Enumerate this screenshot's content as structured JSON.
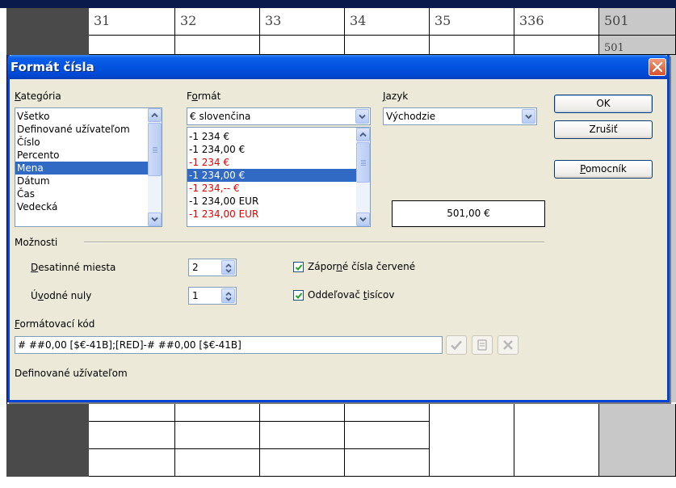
{
  "sheet": {
    "col_headers": [
      "31",
      "32",
      "33",
      "34",
      "35",
      "336",
      "501"
    ],
    "row2_value": "501"
  },
  "dialog": {
    "title": "Formát čísla",
    "category": {
      "label": "Kategória",
      "items": [
        "Všetko",
        "Definované užívateľom",
        "Číslo",
        "Percento",
        "Mena",
        "Dátum",
        "Čas",
        "Vedecká"
      ],
      "selected_index": 4
    },
    "format": {
      "label": "Formát",
      "currency_combo_value": "€ slovenčina",
      "items": [
        {
          "text": "-1 234 €",
          "negative_red": false
        },
        {
          "text": "-1 234,00 €",
          "negative_red": false
        },
        {
          "text": "-1 234 €",
          "negative_red": true
        },
        {
          "text": "-1 234,00 €",
          "negative_red": true
        },
        {
          "text": "-1 234,-- €",
          "negative_red": true
        },
        {
          "text": "-1 234,00 EUR",
          "negative_red": false
        },
        {
          "text": "-1 234,00 EUR",
          "negative_red": true
        }
      ],
      "selected_index": 3
    },
    "language": {
      "label": "Jazyk",
      "value": "Východzie"
    },
    "buttons": {
      "ok": "OK",
      "cancel": "Zrušiť",
      "help": "Pomocník"
    },
    "preview": "501,00 €",
    "options": {
      "label": "Možnosti",
      "decimal_places_label": "Desatinné miesta",
      "decimal_places_value": "2",
      "leading_zeros_label": "Úvodné nuly",
      "leading_zeros_value": "1",
      "negative_red_label": "Záporné čísla červené",
      "negative_red_checked": true,
      "thousands_sep_label": "Oddeľovač tisícov",
      "thousands_sep_checked": true
    },
    "format_code": {
      "label": "Formátovací kód",
      "value": "# ##0,00 [$€-41B];[RED]-# ##0,00 [$€-41B]"
    },
    "status_text": "Definované užívateľom"
  },
  "colors": {
    "selection": "#316ac5",
    "negative": "#e00000",
    "dialog_bg": "#ece9d8",
    "titlebar": "#0254e0"
  }
}
